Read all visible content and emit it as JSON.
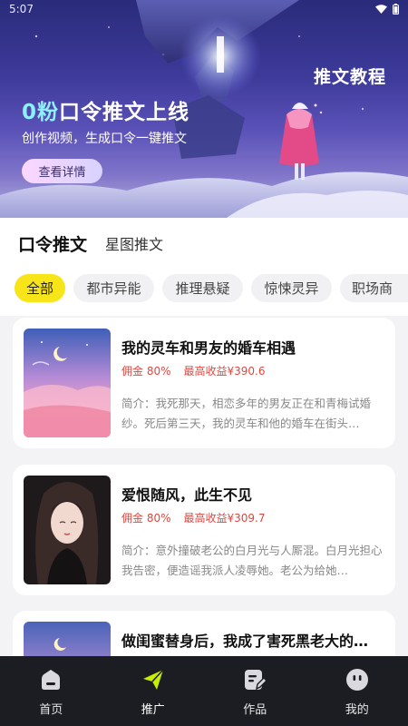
{
  "status_bar": {
    "time": "5:07"
  },
  "banner": {
    "tutorial_label": "推文教程",
    "title_highlight": "0粉",
    "title_rest": "口令推文上线",
    "subtitle": "创作视频，生成口令一键推文",
    "cta_label": "查看详情"
  },
  "tabs": [
    {
      "label": "口令推文",
      "active": true
    },
    {
      "label": "星图推文",
      "active": false
    }
  ],
  "categories": [
    {
      "label": "全部",
      "active": true
    },
    {
      "label": "都市异能",
      "active": false
    },
    {
      "label": "推理悬疑",
      "active": false
    },
    {
      "label": "惊悚灵异",
      "active": false
    },
    {
      "label": "职场商",
      "active": false
    }
  ],
  "books": [
    {
      "title": "我的灵车和男友的婚车相遇",
      "commission": "佣金 80%",
      "max_earnings": "最高收益¥390.6",
      "description": "简介：我死那天，相恋多年的男友正在和青梅试婚纱。死后第三天，我的灵车和他的婚车在街头…"
    },
    {
      "title": "爱恨随风，此生不见",
      "commission": "佣金 80%",
      "max_earnings": "最高收益¥309.7",
      "description": "简介：意外撞破老公的白月光与人厮混。白月光担心我告密，便造谣我派人凌辱她。老公为给她…"
    },
    {
      "title": "做闺蜜替身后，我成了害死黑老大的…",
      "commission": "",
      "max_earnings": "",
      "description": ""
    }
  ],
  "bottom_nav": [
    {
      "label": "首页",
      "icon": "home-icon",
      "active": false
    },
    {
      "label": "推广",
      "icon": "paper-plane-icon",
      "active": true
    },
    {
      "label": "作品",
      "icon": "edit-doc-icon",
      "active": false
    },
    {
      "label": "我的",
      "icon": "profile-face-icon",
      "active": false
    }
  ],
  "colors": {
    "accent_yellow": "#f7e51a",
    "accent_green": "#c6f000",
    "price_red": "#e0463f",
    "nav_bg": "#1c1d22"
  }
}
